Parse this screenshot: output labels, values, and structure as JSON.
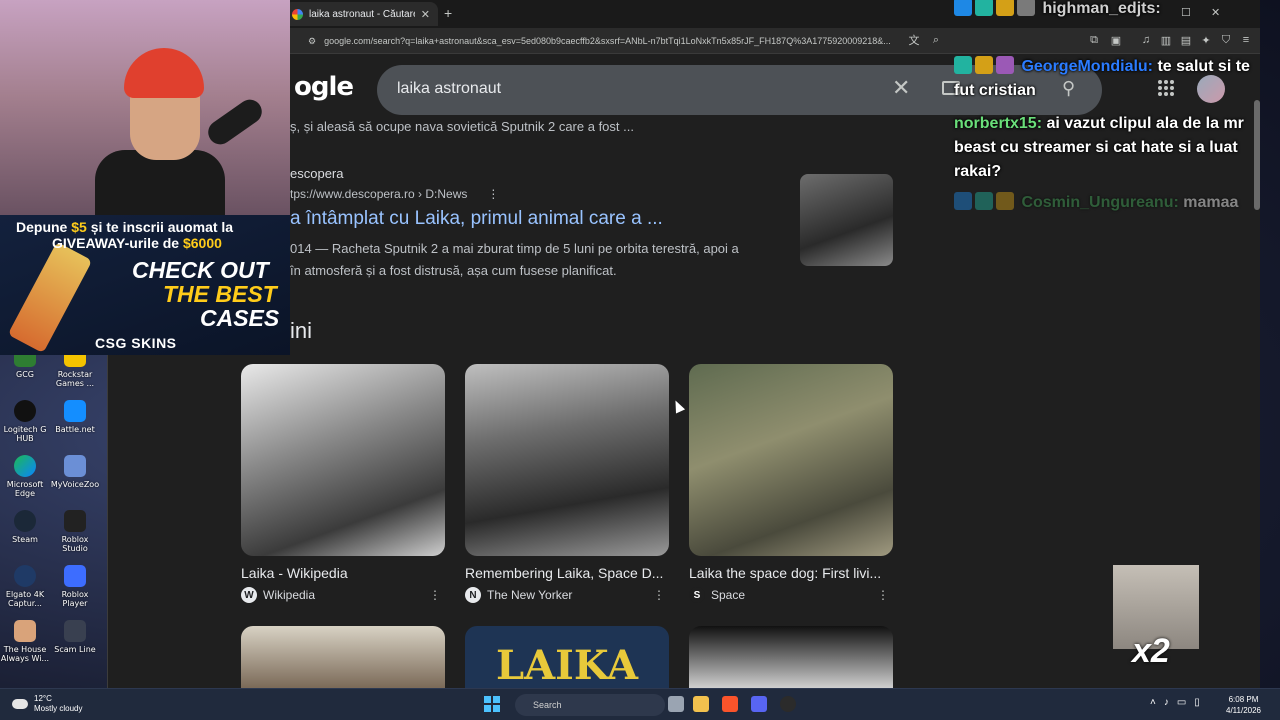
{
  "browser": {
    "tab_title": "laika astronaut - Căutare Google",
    "url": "google.com/search?q=laika+astronaut&sca_esv=5ed080b9caecffb2&sxsrf=ANbL-n7btTqi1LoNxkTn5x85rJF_FH187Q%3A1775920009218&..."
  },
  "google": {
    "logo_partial": "ogle",
    "query": "laika astronaut",
    "snippet_top": "ș, și aleasă să ocupe nava sovietică Sputnik 2 care a fost ...",
    "result": {
      "site": "escopera",
      "breadcrumb": "tps://www.descopera.ro › D:News",
      "title": "a întâmplat cu Laika, primul animal care a ...",
      "desc_line1": "014 — Racheta Sputnik 2 a mai zburat timp de 5 luni pe orbita terestră, apoi a",
      "desc_line2": "în atmosferă și a fost distrusă, așa cum fusese planificat."
    },
    "section_heading": "ini",
    "images": [
      {
        "caption": "Laika - Wikipedia",
        "source": "Wikipedia",
        "source_initial": "W"
      },
      {
        "caption": "Remembering Laika, Space D...",
        "source": "The New Yorker",
        "source_initial": "N"
      },
      {
        "caption": "Laika the space dog: First livi...",
        "source": "Space",
        "source_initial": "S"
      }
    ],
    "second_row_banner": "LAIKA"
  },
  "overlay": {
    "ad_line1_a": "Depune ",
    "ad_line1_amount": "$5",
    "ad_line1_b": " și te inscrii auomat la",
    "ad_line2_a": "GIVEAWAY-urile de ",
    "ad_line2_amount": "$6000",
    "ad_check": "CHECK OUT",
    "ad_best": "THE BEST",
    "ad_cases": "CASES",
    "ad_brand": "CSG SKINS",
    "chat": [
      {
        "user": "highman_edjts:",
        "text": ""
      },
      {
        "user": "GeorgeMondialu:",
        "text": "te salut si te fut cristian"
      },
      {
        "user": "norbertx15:",
        "text": "ai vazut clipul ala de la mr beast cu streamer si cat hate si a luat rakai?"
      },
      {
        "user": "Cosmin_Ungureanu:",
        "text": "mamaa"
      }
    ],
    "emote_multiplier": "x2"
  },
  "desktop_icons": [
    {
      "label": "GCG"
    },
    {
      "label": "Rockstar Games ..."
    },
    {
      "label": "Logitech G HUB"
    },
    {
      "label": "Battle.net"
    },
    {
      "label": "Microsoft Edge"
    },
    {
      "label": "MyVoiceZoo"
    },
    {
      "label": "Steam"
    },
    {
      "label": "Roblox Studio"
    },
    {
      "label": "Elgato 4K Captur..."
    },
    {
      "label": "Roblox Player"
    },
    {
      "label": "The House Always Wi..."
    },
    {
      "label": "Scam Line"
    }
  ],
  "taskbar": {
    "weather_temp": "12°C",
    "weather_desc": "Mostly cloudy",
    "search_label": "Search",
    "time": "6:08 PM",
    "date": "4/11/2026"
  }
}
